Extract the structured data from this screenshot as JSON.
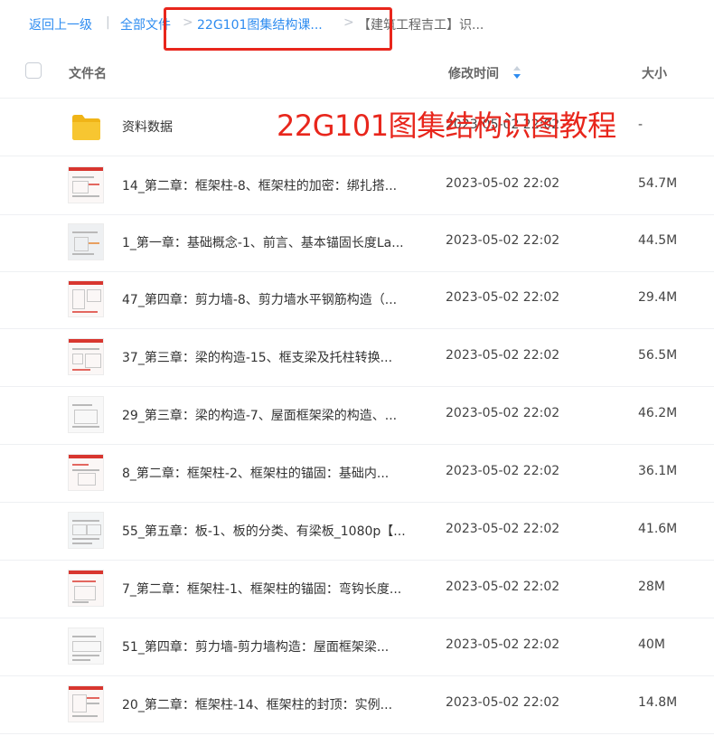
{
  "breadcrumb": {
    "back": "返回上一级",
    "sep1": "|",
    "root": "全部文件",
    "sep2": ">",
    "folder": "22G101图集结构课...",
    "sep3": ">",
    "current": "【建筑工程吉工】识..."
  },
  "header": {
    "name": "文件名",
    "modified": "修改时间",
    "size": "大小"
  },
  "overlay": {
    "title": "22G101图集结构识图教程"
  },
  "rows": [
    {
      "name": "资料数据",
      "time": "2023-05-02 22:02",
      "size": "-",
      "kind": "folder"
    },
    {
      "name": "14_第二章：框架柱-8、框架柱的加密：绑扎搭...",
      "time": "2023-05-02 22:02",
      "size": "54.7M",
      "kind": "video"
    },
    {
      "name": "1_第一章：基础概念-1、前言、基本锚固长度La...",
      "time": "2023-05-02 22:02",
      "size": "44.5M",
      "kind": "video"
    },
    {
      "name": "47_第四章：剪力墙-8、剪力墙水平钢筋构造（...",
      "time": "2023-05-02 22:02",
      "size": "29.4M",
      "kind": "video"
    },
    {
      "name": "37_第三章：梁的构造-15、框支梁及托柱转换...",
      "time": "2023-05-02 22:02",
      "size": "56.5M",
      "kind": "video"
    },
    {
      "name": "29_第三章：梁的构造-7、屋面框架梁的构造、...",
      "time": "2023-05-02 22:02",
      "size": "46.2M",
      "kind": "video"
    },
    {
      "name": "8_第二章：框架柱-2、框架柱的锚固：基础内...",
      "time": "2023-05-02 22:02",
      "size": "36.1M",
      "kind": "video"
    },
    {
      "name": "55_第五章：板-1、板的分类、有梁板_1080p【...",
      "time": "2023-05-02 22:02",
      "size": "41.6M",
      "kind": "video"
    },
    {
      "name": "7_第二章：框架柱-1、框架柱的锚固：弯钩长度...",
      "time": "2023-05-02 22:02",
      "size": "28M",
      "kind": "video"
    },
    {
      "name": "51_第四章：剪力墙-剪力墙构造：屋面框架梁...",
      "time": "2023-05-02 22:02",
      "size": "40M",
      "kind": "video"
    },
    {
      "name": "20_第二章：框架柱-14、框架柱的封顶：实例...",
      "time": "2023-05-02 22:02",
      "size": "14.8M",
      "kind": "video"
    }
  ],
  "colors": {
    "link": "#2e8cf0",
    "highlight": "#e8261c",
    "folder": "#f5c028"
  }
}
